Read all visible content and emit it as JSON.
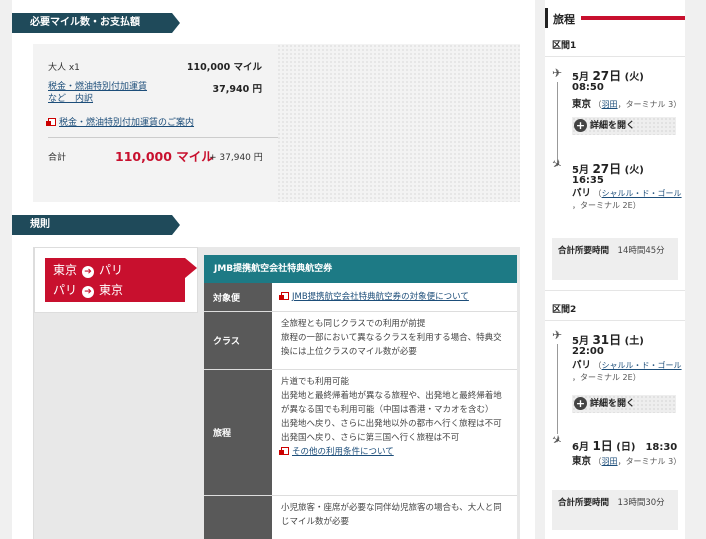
{
  "payment": {
    "heading": "必要マイル数・お支払額",
    "adult_label": "大人 x1",
    "adult_value": "110,000 マイル",
    "tax_link_line1": "税金・燃油特別付加運賃",
    "tax_link_line2": "など　内訳",
    "tax_value": "37,940 円",
    "fuel_info_link": "税金・燃油特別付加運賃のご案内",
    "total_label": "合計",
    "total_miles": "110,000 マイル",
    "total_yen": "+ 37,940 円"
  },
  "rules": {
    "heading": "規則",
    "route1": {
      "from": "東京",
      "to": "パリ"
    },
    "route2": {
      "from": "パリ",
      "to": "東京"
    },
    "arrow": "➔",
    "ticket_type": "JMB提携航空会社特典航空券",
    "rows": [
      {
        "label": "対象便",
        "link": "JMB提携航空会社特典航空券の対象便について"
      },
      {
        "label": "クラス",
        "lines": [
          "全旅程とも同じクラスでの利用が前提",
          "旅程の一部において異なるクラスを利用する場合、特典交換には上位クラスのマイル数が必要"
        ]
      },
      {
        "label": "旅程",
        "lines": [
          "片道でも利用可能",
          "出発地と最終帰着地が異なる旅程や、出発地と最終帰着地が異なる国でも利用可能（中国は香港・マカオを含む）",
          "出発地へ戻り、さらに出発地以外の都市へ行く旅程は不可",
          "出発国へ戻り、さらに第三国へ行く旅程は不可"
        ],
        "link": "その他の利用条件について"
      },
      {
        "label": "",
        "lines": [
          "小児旅客・座席が必要な同伴幼児旅客の場合も、大人と同じマイル数が必要"
        ]
      }
    ]
  },
  "itinerary": {
    "heading": "旅程",
    "segments": [
      {
        "label": "区間1",
        "dep_date": "5月",
        "dep_day": "27日",
        "dep_dow": "(火)",
        "dep_time": "08:50",
        "dep_city": "東京",
        "dep_airport": "羽田",
        "dep_terminal": "ターミナル 3",
        "detail_label": "詳細を開く",
        "arr_date": "5月",
        "arr_day": "27日",
        "arr_dow": "(火)",
        "arr_time": "16:35",
        "arr_city": "パリ",
        "arr_airport": "シャルル・ド・ゴール",
        "arr_terminal": "ターミナル 2E",
        "total_label": "合計所要時間",
        "total_time": "14時間45分"
      },
      {
        "label": "区間2",
        "dep_date": "5月",
        "dep_day": "31日",
        "dep_dow": "(土)",
        "dep_time": "22:00",
        "dep_city": "パリ",
        "dep_airport": "シャルル・ド・ゴール",
        "dep_terminal": "ターミナル 2E",
        "detail_label": "詳細を開く",
        "arr_date": "6月",
        "arr_day": "1日",
        "arr_dow": "(日)",
        "arr_time": "18:30",
        "arr_city": "東京",
        "arr_airport": "羽田",
        "arr_terminal": "ターミナル 3",
        "total_label": "合計所要時間",
        "total_time": "13時間30分"
      }
    ]
  },
  "colors": {
    "accent_red": "#c8102e",
    "navy": "#1f4a5a",
    "teal": "#1d7a85"
  },
  "icons": [
    "external-link-icon",
    "arrow-right-icon",
    "plane-takeoff-icon",
    "plane-landing-icon",
    "plus-icon"
  ]
}
